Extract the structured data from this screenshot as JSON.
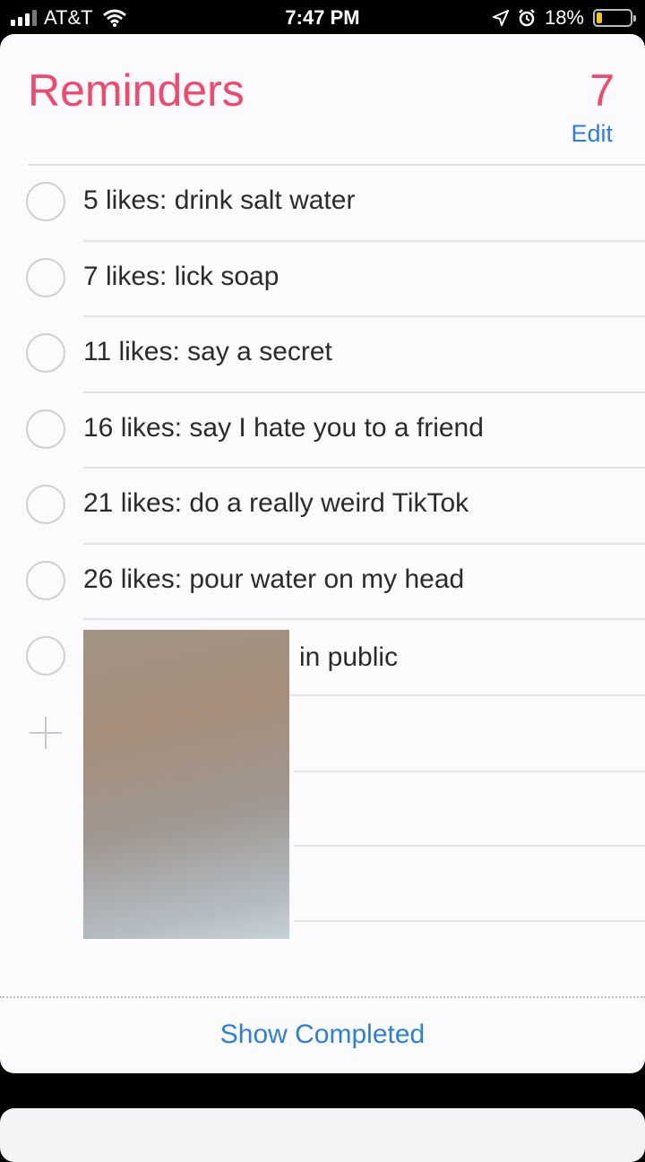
{
  "status_bar": {
    "carrier": "AT&T",
    "time": "7:47 PM",
    "battery": "18%",
    "battery_level": 0.18,
    "icons": [
      "signal-icon",
      "wifi-icon",
      "location-icon",
      "alarm-icon",
      "battery-icon"
    ]
  },
  "list": {
    "title": "Reminders",
    "count": "7",
    "edit_label": "Edit",
    "accent_color": "#f0496d",
    "link_color": "#2c7fd6",
    "items": [
      {
        "text": "5 likes: drink salt water"
      },
      {
        "text": "7 likes: lick soap"
      },
      {
        "text": "11 likes: say a secret"
      },
      {
        "text": "16 likes: say I hate you to a friend"
      },
      {
        "text": "21 likes: do a really weird TikTok"
      },
      {
        "text": "26 likes: pour water on my head"
      },
      {
        "text": "in public"
      }
    ],
    "add_icon": "plus-icon",
    "show_completed_label": "Show Completed"
  }
}
